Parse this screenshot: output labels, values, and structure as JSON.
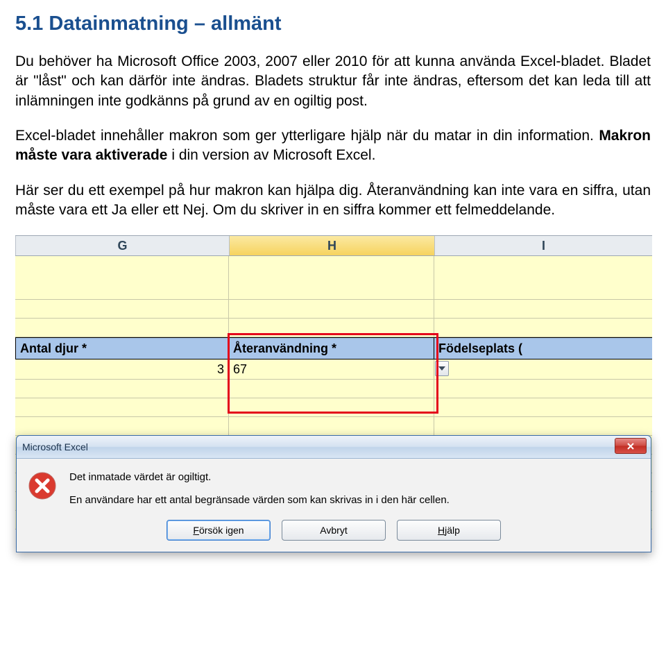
{
  "heading": "5.1 Datainmatning – allmänt",
  "para1": "Du behöver ha Microsoft Office 2003, 2007 eller 2010 för att kunna använda Excel-bladet. Bladet är \"låst\" och kan därför inte ändras. Bladets struktur får inte ändras, eftersom det kan leda till att inlämningen inte godkänns på grund av en ogiltig post.",
  "para2_a": "Excel-bladet innehåller makron som ger ytterligare hjälp när du matar in din information. ",
  "para2_bold": "Makron måste vara aktiverade",
  "para2_b": " i din version av Microsoft Excel.",
  "para3": "Här ser du ett exempel på hur makron kan hjälpa dig. Återanvändning kan inte vara en siffra, utan måste vara ett Ja eller ett Nej. Om du skriver in en siffra kommer ett felmeddelande.",
  "excel": {
    "col_letters": {
      "g": "G",
      "h": "H",
      "i": "I"
    },
    "headers": {
      "g": "Antal djur *",
      "h": "Återanvändning *",
      "i": "Födelseplats ("
    },
    "row1": {
      "g": "3",
      "h": "67"
    }
  },
  "dialog": {
    "title": "Microsoft Excel",
    "line1": "Det inmatade värdet är ogiltigt.",
    "line2": "En användare har ett antal begränsade värden som kan skrivas in i den här cellen.",
    "buttons": {
      "retry_u": "F",
      "retry_rest": "örsök igen",
      "cancel": "Avbryt",
      "help_u": "H",
      "help_rest": "jälp"
    }
  }
}
